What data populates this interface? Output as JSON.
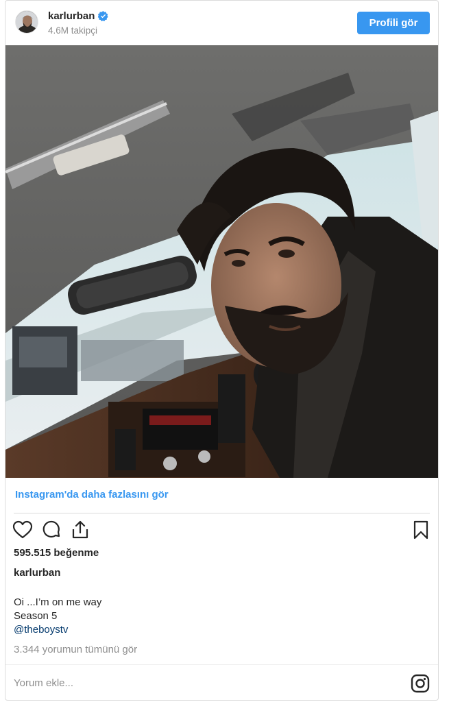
{
  "header": {
    "username": "karlurban",
    "followers": "4.6M takipçi",
    "profile_button": "Profili gör"
  },
  "post": {
    "more_on_instagram": "Instagram'da daha fazlasını gör",
    "likes": "595.515 beğenme",
    "caption_username": "karlurban",
    "caption_lines": [
      "Oi ...I’m on me way",
      "Season 5"
    ],
    "mention": "@theboystv",
    "view_comments": "3.344 yorumun tümünü gör"
  },
  "comment_box": {
    "placeholder": "Yorum ekle..."
  },
  "icons": {
    "verified": "verified-badge-icon",
    "like": "heart-icon",
    "comment": "comment-bubble-icon",
    "share": "share-icon",
    "save": "bookmark-icon",
    "instagram": "instagram-logo-icon"
  },
  "colors": {
    "accent": "#3897f0",
    "text": "#262626",
    "muted": "#8e8e8e",
    "mention": "#00376b",
    "border": "#dbdbdb"
  }
}
